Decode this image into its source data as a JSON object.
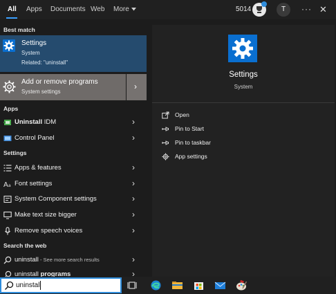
{
  "tabs": [
    "All",
    "Apps",
    "Documents",
    "Web",
    "More"
  ],
  "header": {
    "score": "5014",
    "avatar_initial": "T",
    "more_dots": "···",
    "close": "✕"
  },
  "sections": {
    "best_match": "Best match",
    "apps": "Apps",
    "settings": "Settings",
    "search_web": "Search the web"
  },
  "best_match": {
    "title": "Settings",
    "subtitle": "System",
    "related": "Related: \"uninstall\""
  },
  "selected": {
    "title": "Add or remove programs",
    "subtitle": "System settings"
  },
  "apps": [
    {
      "bold": "Uninstall",
      "rest": " IDM"
    },
    {
      "label": "Control Panel"
    }
  ],
  "settings_items": [
    {
      "label": "Apps & features"
    },
    {
      "label": "Font settings"
    },
    {
      "label": "System Component settings"
    },
    {
      "label": "Make text size bigger"
    },
    {
      "label": "Remove speech voices"
    }
  ],
  "web_items": [
    {
      "term": "uninstall",
      "suffix": " - See more search results"
    },
    {
      "term": "uninstall ",
      "suffix": "programs"
    }
  ],
  "preview": {
    "title": "Settings",
    "subtitle": "System",
    "actions": [
      "Open",
      "Pin to Start",
      "Pin to taskbar",
      "App settings"
    ]
  },
  "search": {
    "value": "uninstall"
  },
  "colors": {
    "accent": "#0a6fd0",
    "selected_bg": "#6f6b69",
    "best_bg": "#254b6e",
    "focus": "#2f8ddc"
  },
  "icons": {
    "taskbar": [
      "task-view-icon",
      "edge-icon",
      "file-explorer-icon",
      "store-icon",
      "mail-icon",
      "paint-icon"
    ]
  }
}
